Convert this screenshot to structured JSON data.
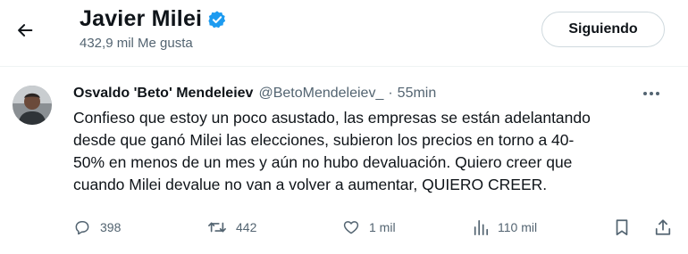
{
  "header": {
    "profile_name": "Javier Milei",
    "likes_count": "432,9 mil Me gusta",
    "follow_label": "Siguiendo"
  },
  "tweet": {
    "author_name": "Osvaldo 'Beto' Mendeleiev",
    "author_handle": "@BetoMendeleiev_",
    "separator": "·",
    "timestamp": "55min",
    "text_lines": [
      "Confieso que estoy un poco asustado, las empresas se están adelantando",
      "desde que ganó Milei las elecciones, subieron los precios en torno a 40-",
      "50% en menos de un mes y aún no hubo devaluación. Quiero creer que",
      "cuando Milei devalue no van a volver a aumentar, QUIERO CREER."
    ],
    "actions": {
      "replies": "398",
      "retweets": "442",
      "likes": "1 mil",
      "views": "110 mil"
    }
  },
  "icons": {
    "back": "arrow-left-icon",
    "verified": "verified-badge-icon",
    "more": "more-horizontal-icon",
    "reply": "reply-icon",
    "retweet": "retweet-icon",
    "like": "heart-icon",
    "views": "views-icon",
    "bookmark": "bookmark-icon",
    "share": "share-icon"
  },
  "colors": {
    "text_primary": "#0f1419",
    "text_secondary": "#536471",
    "verified_blue": "#1d9bf0",
    "border": "#cfd9de"
  }
}
